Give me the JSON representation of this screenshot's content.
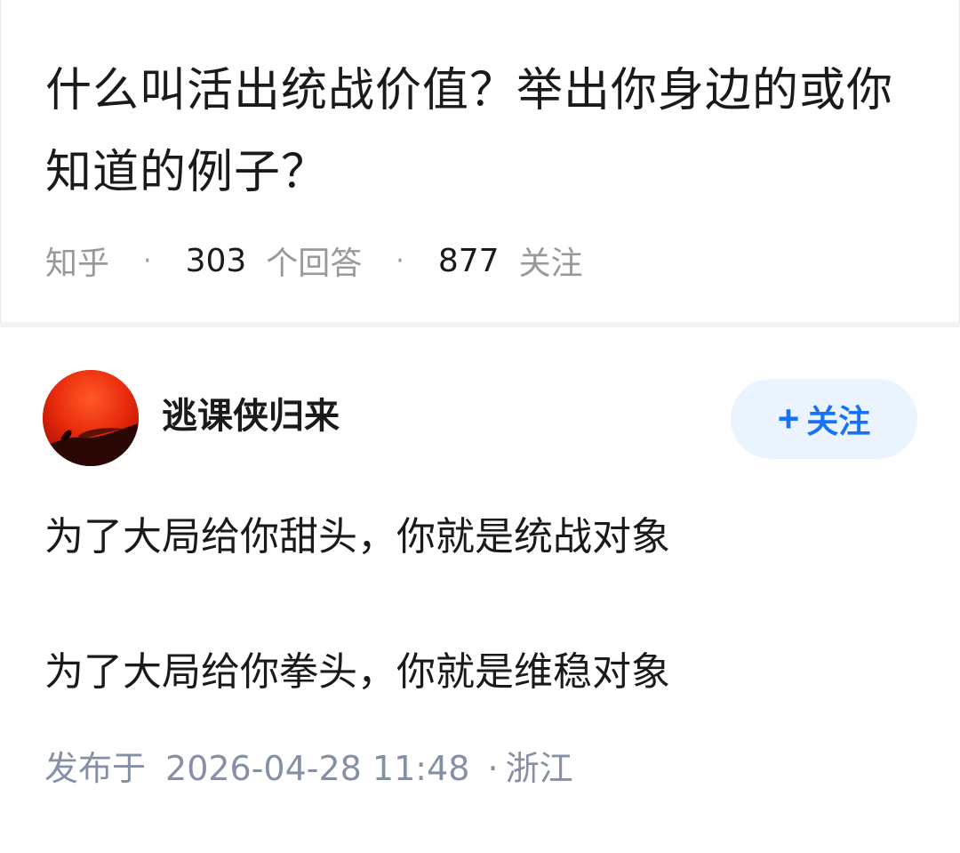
{
  "question": {
    "title": "什么叫活出统战价值？举出你身边的或你知道的例子？",
    "source": "知乎",
    "answer_count": "303",
    "answer_count_label": "个回答",
    "follow_count": "877",
    "follow_count_label": "关注",
    "separator": "·"
  },
  "answer": {
    "author_name": "逃课侠归来",
    "avatar_icon": "sunset-avatar-image",
    "follow_button_label": "关注",
    "follow_button_icon": "plus-icon",
    "paragraphs": [
      "为了大局给你甜头，你就是统战对象",
      "为了大局给你拳头，你就是维稳对象"
    ],
    "publish_label": "发布于",
    "publish_datetime": "2026-04-28  11:48",
    "location_separator": "·",
    "location": "浙江"
  },
  "colors": {
    "follow_accent": "#1772f6",
    "follow_bg": "#ebf3ff",
    "meta_gray": "#8590a6"
  }
}
